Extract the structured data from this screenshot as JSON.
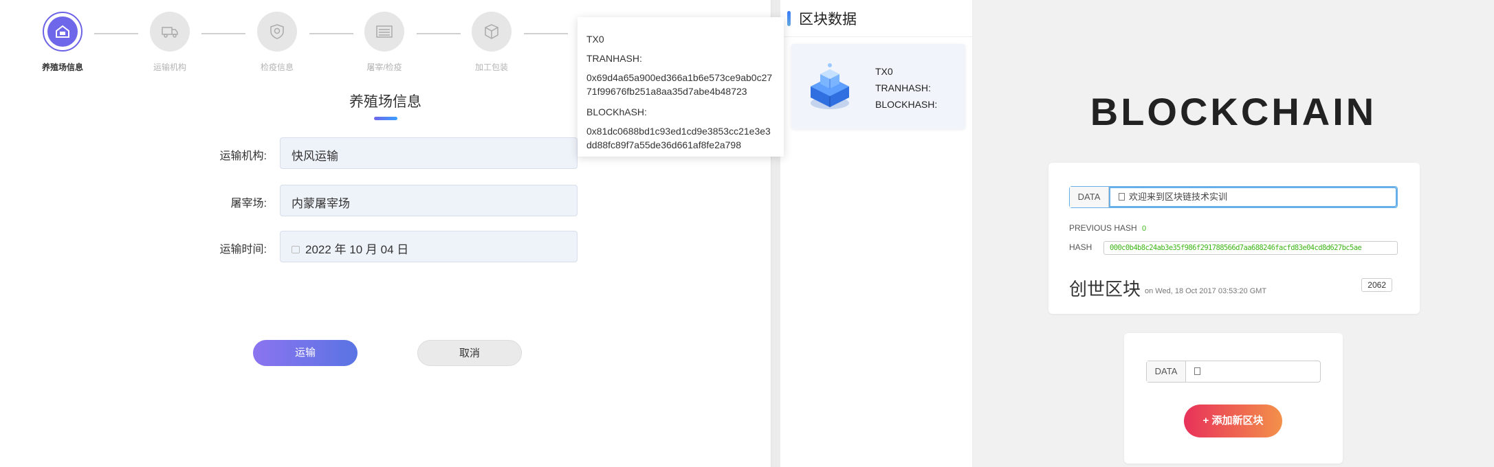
{
  "steps": [
    {
      "label": "养殖场信息",
      "icon": "home-icon"
    },
    {
      "label": "运输机构",
      "icon": "truck-icon"
    },
    {
      "label": "检疫信息",
      "icon": "shield-icon"
    },
    {
      "label": "屠宰/检疫",
      "icon": "list-icon"
    },
    {
      "label": "加工包装",
      "icon": "box-icon"
    }
  ],
  "form": {
    "title": "养殖场信息",
    "fields": [
      {
        "label": "运输机构:",
        "value": "快风运输"
      },
      {
        "label": "屠宰场:",
        "value": "内蒙屠宰场"
      },
      {
        "label": "运输时间:",
        "value": "2022 年 10 月 04 日"
      }
    ],
    "submit": "运输",
    "cancel": "取消"
  },
  "tooltip": {
    "tx": "TX0",
    "tranhash_label": "TRANHASH:",
    "tranhash": "0x69d4a65a900ed366a1b6e573ce9ab0c2771f99676fb251a8aa35d7abe4b48723",
    "blockhash_label": "BLOCKhASH:",
    "blockhash": "0x81dc0688bd1c93ed1cd9e3853cc21e3e3dd88fc89f7a55de36d661af8fe2a798"
  },
  "block_panel": {
    "title": "区块数据",
    "card": {
      "tx": "TX0",
      "tranhash": "TRANHASH:",
      "blockhash": "BLOCKHASH:"
    }
  },
  "blockchain": {
    "brand": "BLOCKCHAIN",
    "block1": {
      "data_tag": "DATA",
      "data_value": "欢迎来到区块链技术实训",
      "prev_hash_label": "PREVIOUS HASH",
      "prev_hash": "0",
      "hash_label": "HASH",
      "hash": "000c0b4b8c24ab3e35f986f291788566d7aa688246facfd83e04cd8d627bc5ae",
      "genesis": "创世区块",
      "timestamp": "on Wed, 18 Oct 2017 03:53:20 GMT",
      "nonce": "2062"
    },
    "block2": {
      "data_tag": "DATA",
      "data_value": "",
      "add_button": "+ 添加新区块"
    }
  },
  "colors": {
    "accent": "#6f67ea",
    "hash_green": "#3fb618",
    "add_start": "#e8315a",
    "add_end": "#f3914a"
  }
}
